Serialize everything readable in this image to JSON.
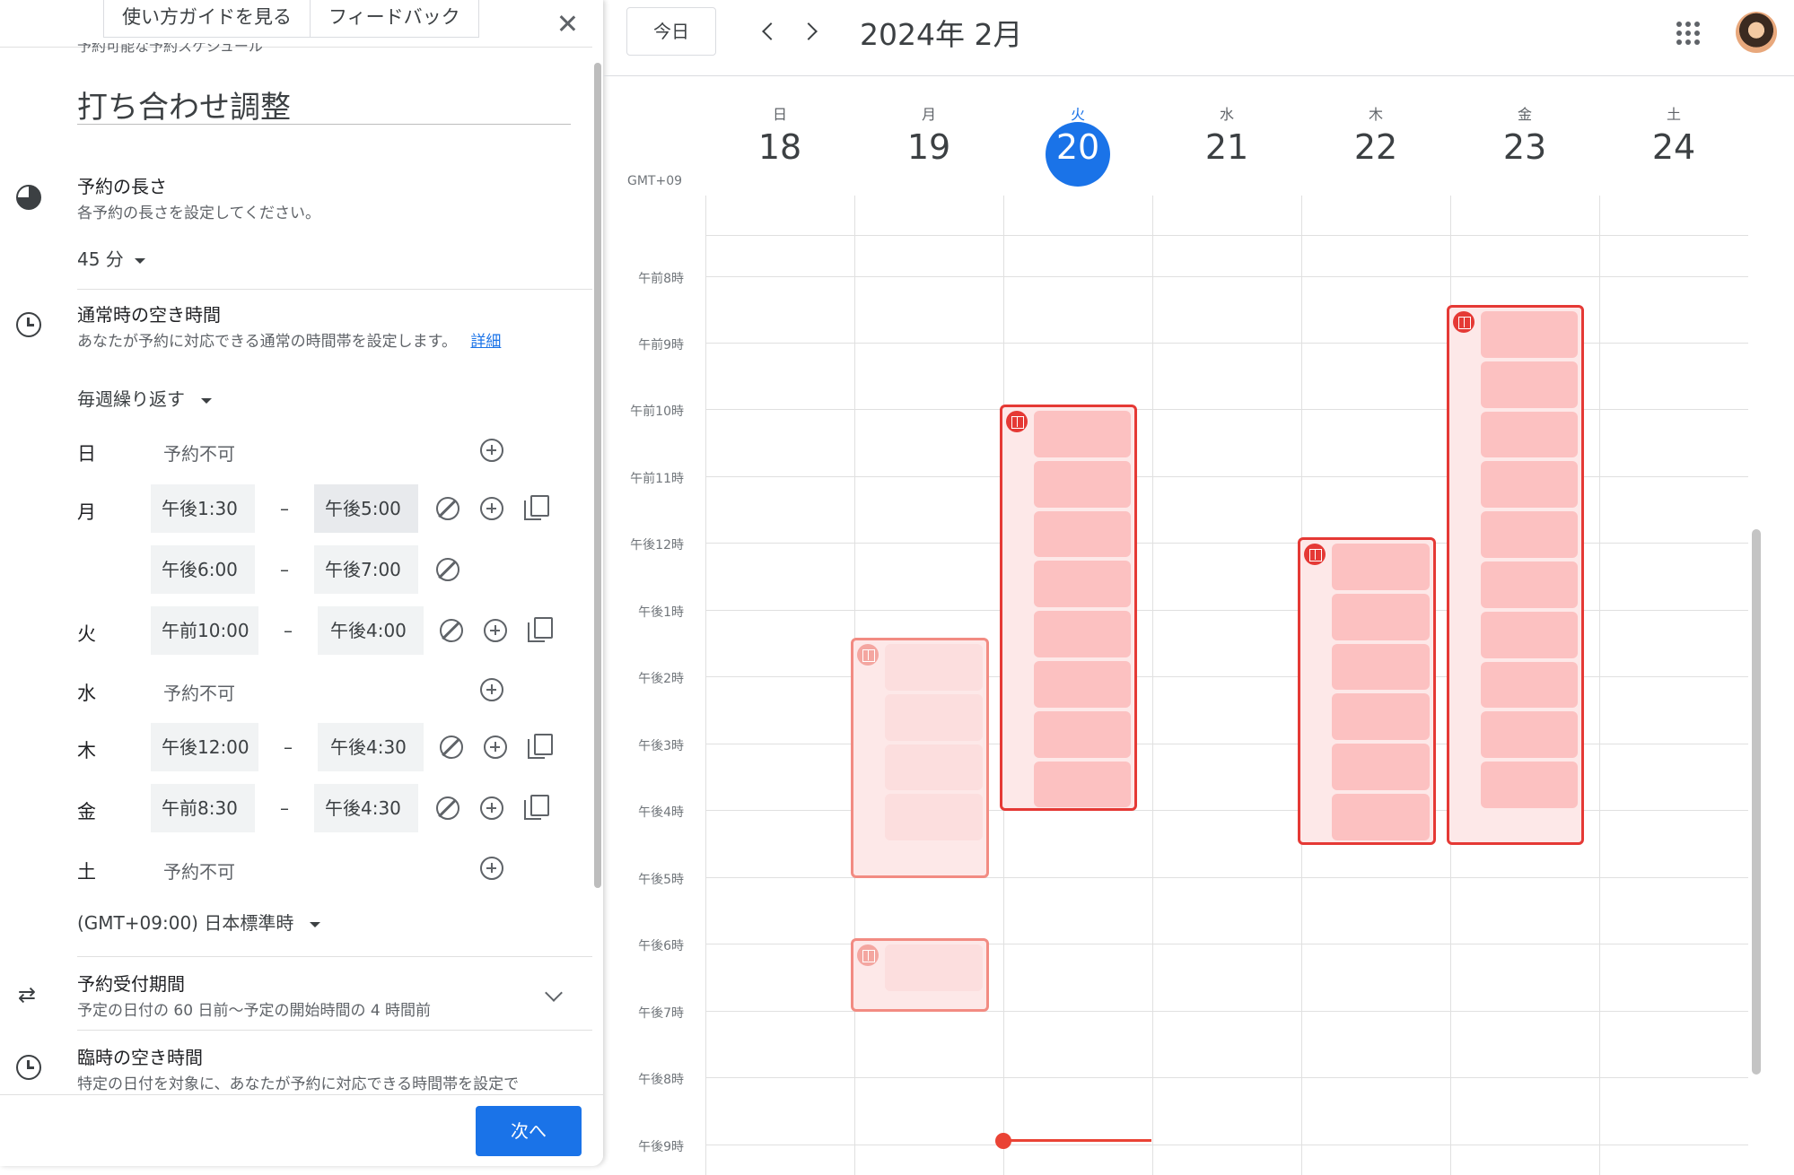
{
  "panel": {
    "tabs": [
      "使い方ガイドを見る",
      "フィードバック"
    ],
    "kicker": "予約可能な予約スケジュール",
    "title": "打ち合わせ調整",
    "duration": {
      "title": "予約の長さ",
      "subtitle": "各予約の長さを設定してください。",
      "value": "45 分"
    },
    "availability": {
      "title": "通常時の空き時間",
      "subtitle": "あなたが予約に対応できる通常の時間帯を設定します。",
      "link": "詳細",
      "repeat": "毎週繰り返す",
      "days": [
        {
          "day": "日",
          "status": "予約不可"
        },
        {
          "day": "月",
          "start": "午後1:30",
          "end": "午後5:00"
        },
        {
          "day": "",
          "start": "午後6:00",
          "end": "午後7:00"
        },
        {
          "day": "火",
          "start": "午前10:00",
          "end": "午後4:00"
        },
        {
          "day": "水",
          "status": "予約不可"
        },
        {
          "day": "木",
          "start": "午後12:00",
          "end": "午後4:30"
        },
        {
          "day": "金",
          "start": "午前8:30",
          "end": "午後4:30"
        },
        {
          "day": "土",
          "status": "予約不可"
        }
      ],
      "dash": "–",
      "timezone": "(GMT+09:00) 日本標準時"
    },
    "period": {
      "title": "予約受付期間",
      "subtitle": "予定の日付の 60 日前〜予定の開始時間の 4 時間前"
    },
    "temp": {
      "title": "臨時の空き時間",
      "subtitle": "特定の日付を対象に、あなたが予約に対応できる時間帯を設定で"
    },
    "next_label": "次へ"
  },
  "calendar": {
    "today_label": "今日",
    "month_title": "2024年 2月",
    "gmt_label": "GMT+09",
    "days": [
      {
        "dow": "日",
        "num": "18"
      },
      {
        "dow": "月",
        "num": "19"
      },
      {
        "dow": "火",
        "num": "20",
        "today": true
      },
      {
        "dow": "水",
        "num": "21"
      },
      {
        "dow": "木",
        "num": "22"
      },
      {
        "dow": "金",
        "num": "23"
      },
      {
        "dow": "土",
        "num": "24"
      }
    ],
    "hours": [
      "午前8時",
      "午前9時",
      "午前10時",
      "午前11時",
      "午後12時",
      "午後1時",
      "午後2時",
      "午後3時",
      "午後4時",
      "午後5時",
      "午後6時",
      "午後7時",
      "午後8時",
      "午後9時"
    ],
    "accent_color": "#1a73e8",
    "slot_border_color": "#e53935"
  }
}
